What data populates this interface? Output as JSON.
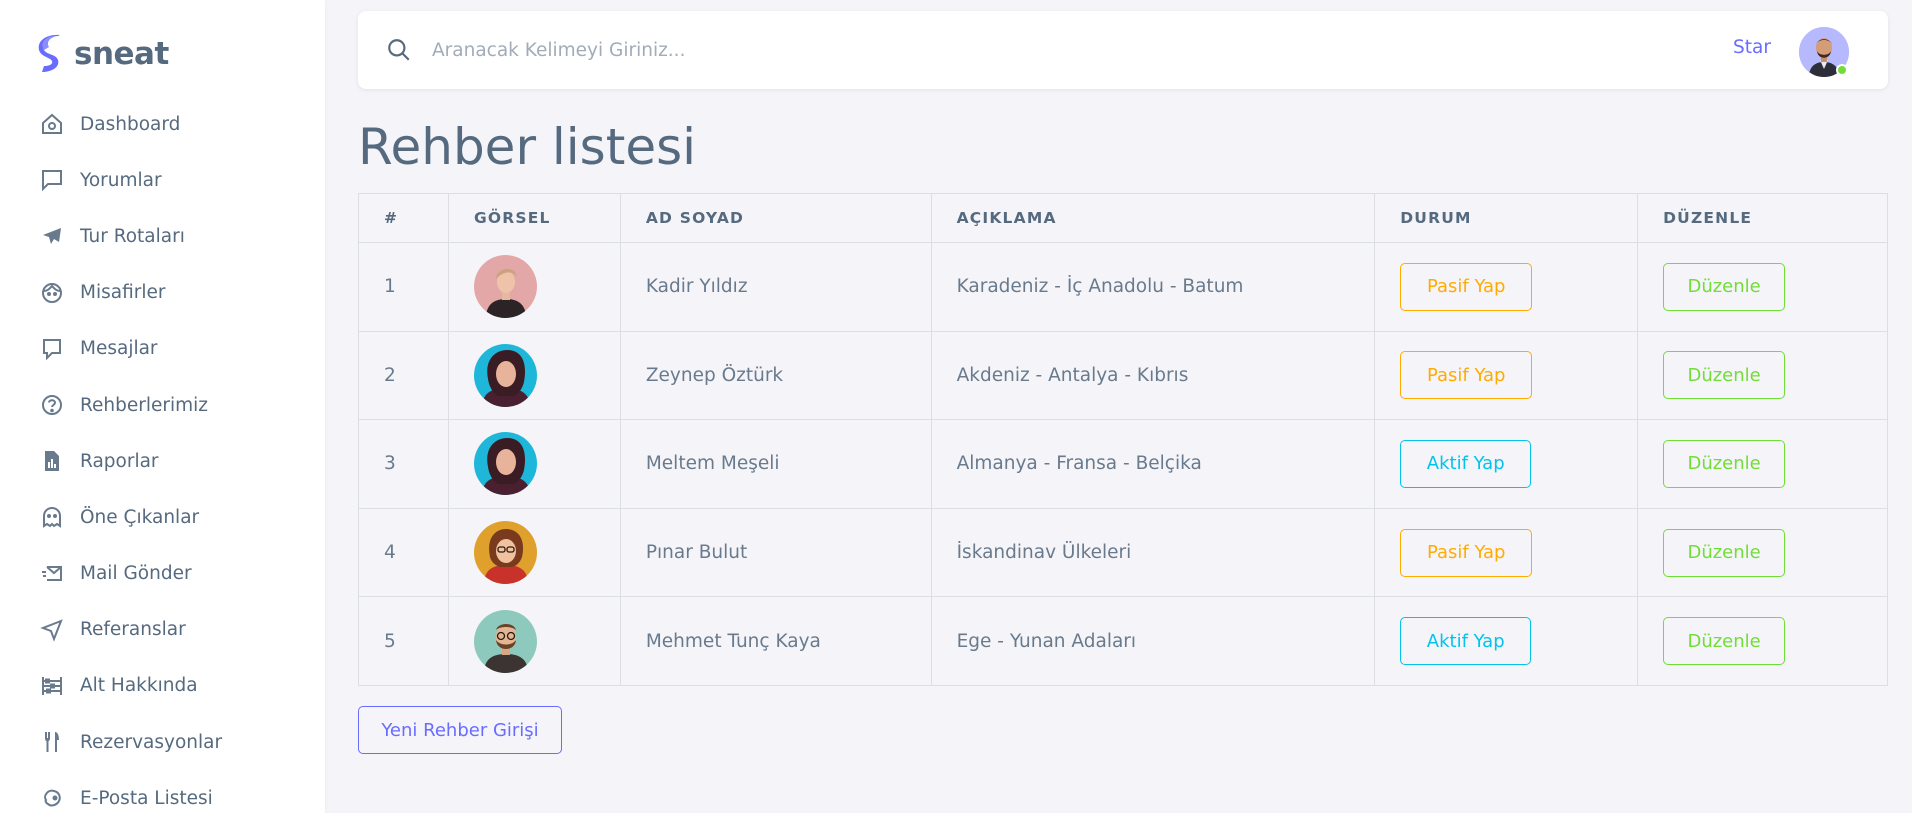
{
  "brand": {
    "name": "sneat",
    "accent": "#696cff"
  },
  "sidebar": {
    "items": [
      {
        "label": "Dashboard",
        "icon": "home-icon"
      },
      {
        "label": "Yorumlar",
        "icon": "comment-icon"
      },
      {
        "label": "Tur Rotaları",
        "icon": "plane-icon"
      },
      {
        "label": "Misafirler",
        "icon": "face-icon"
      },
      {
        "label": "Mesajlar",
        "icon": "message-icon"
      },
      {
        "label": "Rehberlerimiz",
        "icon": "help-circle-icon"
      },
      {
        "label": "Raporlar",
        "icon": "report-icon"
      },
      {
        "label": "Öne Çıkanlar",
        "icon": "ghost-icon"
      },
      {
        "label": "Mail Gönder",
        "icon": "mail-send-icon"
      },
      {
        "label": "Referanslar",
        "icon": "navigation-icon"
      },
      {
        "label": "Alt Hakkında",
        "icon": "abacus-icon"
      },
      {
        "label": "Rezervasyonlar",
        "icon": "restaurant-icon"
      },
      {
        "label": "E-Posta Listesi",
        "icon": "mailchimp-icon"
      }
    ]
  },
  "navbar": {
    "search_placeholder": "Aranacak Kelimeyi Giriniz...",
    "star_label": "Star"
  },
  "page": {
    "title": "Rehber listesi"
  },
  "table": {
    "headers": [
      "#",
      "GÖRSEL",
      "AD SOYAD",
      "AÇIKLAMA",
      "DURUM",
      "DÜZENLE"
    ],
    "rows": [
      {
        "no": "1",
        "name": "Kadir Yıldız",
        "desc": "Karadeniz - İç Anadolu - Batum",
        "status_label": "Pasif Yap",
        "status_type": "warning",
        "edit_label": "Düzenle"
      },
      {
        "no": "2",
        "name": "Zeynep Öztürk",
        "desc": "Akdeniz - Antalya - Kıbrıs",
        "status_label": "Pasif Yap",
        "status_type": "warning",
        "edit_label": "Düzenle"
      },
      {
        "no": "3",
        "name": "Meltem Meşeli",
        "desc": "Almanya - Fransa - Belçika",
        "status_label": "Aktif Yap",
        "status_type": "info",
        "edit_label": "Düzenle"
      },
      {
        "no": "4",
        "name": "Pınar Bulut",
        "desc": "İskandinav Ülkeleri",
        "status_label": "Pasif Yap",
        "status_type": "warning",
        "edit_label": "Düzenle"
      },
      {
        "no": "5",
        "name": "Mehmet Tunç Kaya",
        "desc": "Ege - Yunan Adaları",
        "status_label": "Aktif Yap",
        "status_type": "info",
        "edit_label": "Düzenle"
      }
    ]
  },
  "actions": {
    "new_label": "Yeni Rehber Girişi"
  },
  "colors": {
    "warning": "#ffab00",
    "info": "#03c3ec",
    "success": "#71dd37",
    "primary": "#696cff"
  }
}
